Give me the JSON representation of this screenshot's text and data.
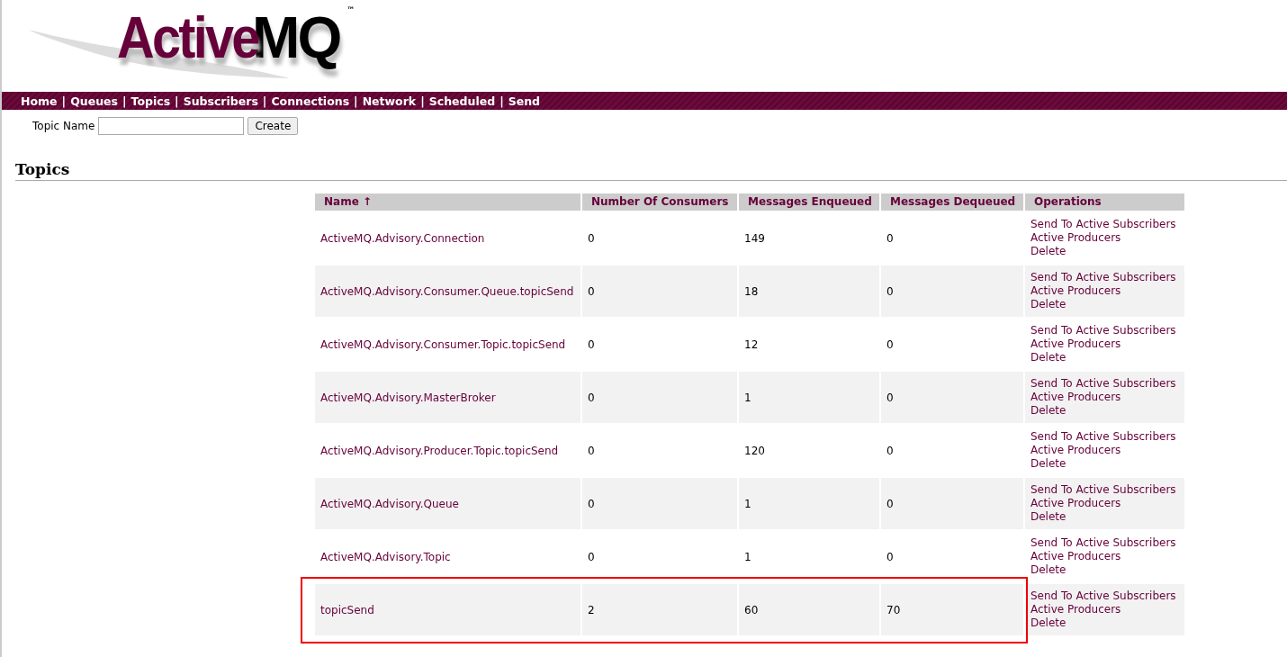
{
  "logo": {
    "part_1": "Active",
    "part_2": "MQ",
    "mark": "™"
  },
  "nav_separator": "|",
  "nav": [
    "Home",
    "Queues",
    "Topics",
    "Subscribers",
    "Connections",
    "Network",
    "Scheduled",
    "Send"
  ],
  "create_form": {
    "label": "Topic Name",
    "button": "Create"
  },
  "heading": "Topics",
  "table": {
    "columns": [
      "Name ↑",
      "Number Of Consumers",
      "Messages Enqueued",
      "Messages Dequeued",
      "Operations"
    ],
    "rows": [
      {
        "name": "ActiveMQ.Advisory.Connection",
        "consumers": "0",
        "enqueued": "149",
        "dequeued": "0",
        "operations": [
          "Send To Active Subscribers",
          "Active Producers",
          "Delete"
        ],
        "highlighted": false
      },
      {
        "name": "ActiveMQ.Advisory.Consumer.Queue.topicSend",
        "consumers": "0",
        "enqueued": "18",
        "dequeued": "0",
        "operations": [
          "Send To Active Subscribers",
          "Active Producers",
          "Delete"
        ],
        "highlighted": false
      },
      {
        "name": "ActiveMQ.Advisory.Consumer.Topic.topicSend",
        "consumers": "0",
        "enqueued": "12",
        "dequeued": "0",
        "operations": [
          "Send To Active Subscribers",
          "Active Producers",
          "Delete"
        ],
        "highlighted": false
      },
      {
        "name": "ActiveMQ.Advisory.MasterBroker",
        "consumers": "0",
        "enqueued": "1",
        "dequeued": "0",
        "operations": [
          "Send To Active Subscribers",
          "Active Producers",
          "Delete"
        ],
        "highlighted": false
      },
      {
        "name": "ActiveMQ.Advisory.Producer.Topic.topicSend",
        "consumers": "0",
        "enqueued": "120",
        "dequeued": "0",
        "operations": [
          "Send To Active Subscribers",
          "Active Producers",
          "Delete"
        ],
        "highlighted": false
      },
      {
        "name": "ActiveMQ.Advisory.Queue",
        "consumers": "0",
        "enqueued": "1",
        "dequeued": "0",
        "operations": [
          "Send To Active Subscribers",
          "Active Producers",
          "Delete"
        ],
        "highlighted": false
      },
      {
        "name": "ActiveMQ.Advisory.Topic",
        "consumers": "0",
        "enqueued": "1",
        "dequeued": "0",
        "operations": [
          "Send To Active Subscribers",
          "Active Producers",
          "Delete"
        ],
        "highlighted": false
      },
      {
        "name": "topicSend",
        "consumers": "2",
        "enqueued": "60",
        "dequeued": "70",
        "operations": [
          "Send To Active Subscribers",
          "Active Producers",
          "Delete"
        ],
        "highlighted": true
      }
    ]
  }
}
